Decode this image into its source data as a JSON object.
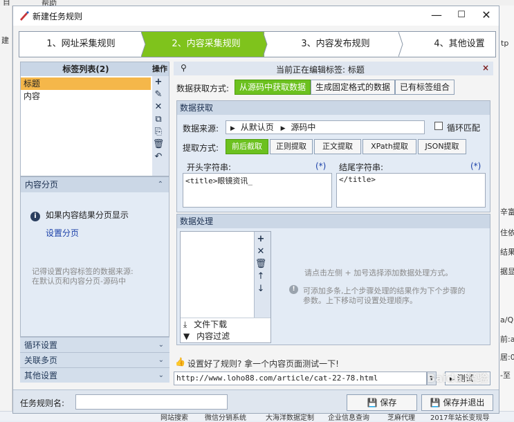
{
  "background": {
    "top_left": "目",
    "top_menu": "帮助",
    "left_text": "建",
    "right_items": [
      "tp",
      "辛富",
      "住依",
      "结果",
      "据显",
      "a/Q",
      "前:a",
      "居:0",
      "-至"
    ],
    "bottom_links": [
      "网站搜索",
      "微信分销系统",
      "大海洋数据定制",
      "企业信息查询",
      "芝麻代理",
      "2017年站长变现导"
    ]
  },
  "dialog": {
    "title": "新建任务规则",
    "min": "—",
    "max": "☐",
    "close": "✕"
  },
  "wizard": {
    "steps": [
      "1、网址采集规则",
      "2、内容采集规则",
      "3、内容发布规则",
      "4、其他设置"
    ]
  },
  "tags": {
    "header": "标签列表(2)",
    "ops_header": "操作",
    "items": [
      "标题",
      "内容"
    ],
    "ops_icons": [
      "+",
      "✎",
      "✕",
      "⧉",
      "⎘",
      "🗑",
      "↶"
    ]
  },
  "content_paging": {
    "header": "内容分页",
    "info": "如果内容结果分页显示",
    "link": "设置分页",
    "hint1": "记得设置内容标签的数据来源:",
    "hint2": "在默认页和内容分页-源码中"
  },
  "collapsed": [
    "循环设置",
    "关联多页",
    "其他设置"
  ],
  "editor": {
    "current": "当前正在编辑标签: 标题",
    "close": "×",
    "method_label": "数据获取方式:",
    "methods": [
      "从源码中获取数据",
      "生成固定格式的数据",
      "已有标签组合"
    ],
    "fetch_header": "数据获取",
    "source_label": "数据来源:",
    "source_path": [
      "从默认页",
      "源码中"
    ],
    "loop_match": "循环匹配",
    "extract_label": "提取方式:",
    "extract_options": [
      "前后截取",
      "正则提取",
      "正文提取",
      "XPath提取",
      "JSON提取"
    ],
    "start_label": "开头字符串:",
    "end_label": "结尾字符串:",
    "star": "(*)",
    "start_value": "<title>眼镜资讯_",
    "end_value": "</title>"
  },
  "processing": {
    "header": "数据处理",
    "icons": [
      "+",
      "✕",
      "🗑",
      "↑",
      "↓"
    ],
    "actions": [
      "文件下载",
      "内容过滤"
    ],
    "hint1": "请点击左侧 + 加号选择添加数据处理方式。",
    "hint2": "可添加多条,上个步骤处理的结果作为下个步骤的",
    "hint3": "参数。上下移动可设置处理顺序。"
  },
  "test": {
    "prompt": "设置好了规则? 拿一个内容页面测试一下!",
    "url": "http://www.loho88.com/article/cat-22-78.html",
    "button": "测试"
  },
  "footer": {
    "name_label": "任务规则名:",
    "name_value": "",
    "save": "保存",
    "save_exit": "保存并退出"
  },
  "watermark": "Baidu 经验",
  "colors": {
    "active_green": "#7fc31c",
    "selected": "#f5b74a",
    "panel": "#dde5f0"
  }
}
